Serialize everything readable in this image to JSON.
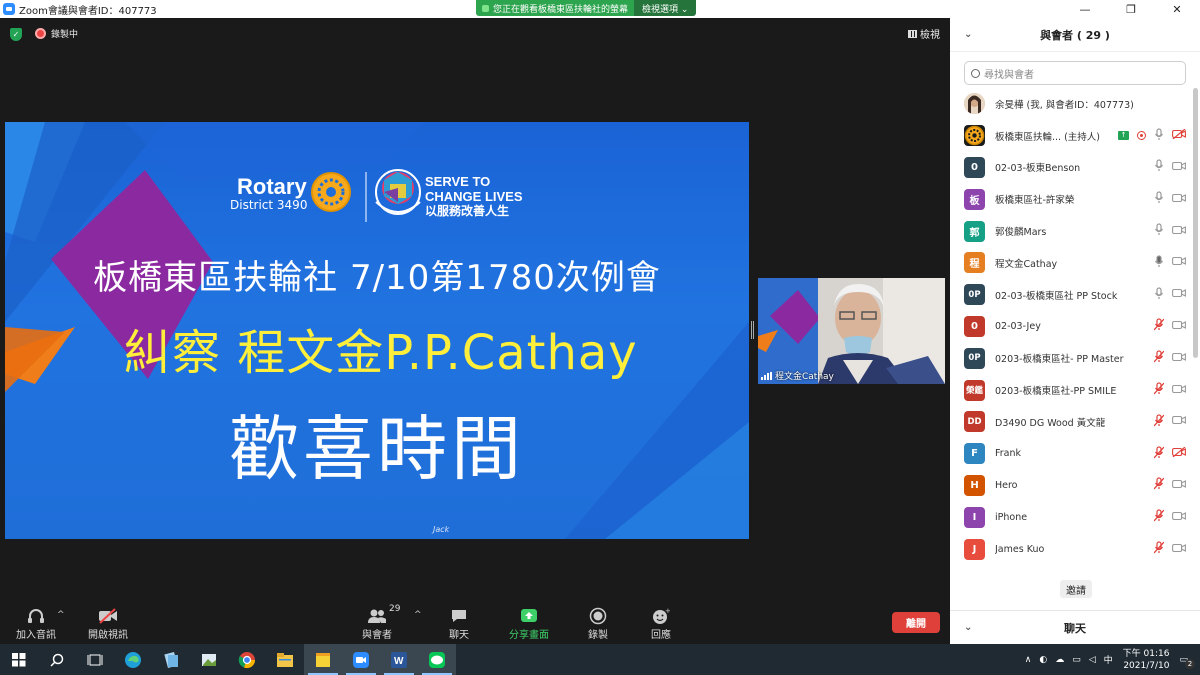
{
  "window": {
    "title": "Zoom會議與會者ID：407773",
    "minimize": "—",
    "maximize": "❐",
    "close": "✕"
  },
  "share_banner": {
    "text": "您正在觀看板橋東區扶輪社的螢幕",
    "options": "檢視選項 ⌄"
  },
  "stage": {
    "recording": "錄製中",
    "view": "檢視"
  },
  "slide": {
    "rotary": "Rotary",
    "district": "District 3490",
    "serve1": "SERVE TO",
    "serve2": "CHANGE LIVES",
    "serve_zh": "以服務改善人生",
    "line1": "板橋東區扶輪社  7/10第1780次例會",
    "line2": "糾察 程文金P.P.Cathay",
    "line3": "歡喜時間",
    "signature": "Jack"
  },
  "camera": {
    "name": "程文金Cathay"
  },
  "toolbar": {
    "audio": "加入音訊",
    "video": "開啟視訊",
    "participants": "與會者",
    "participant_count": "29",
    "chat": "聊天",
    "share": "分享畫面",
    "record": "錄製",
    "reactions": "回應",
    "leave": "離開"
  },
  "panel": {
    "title": "與會者 ( 29 )",
    "search_placeholder": "尋找與會者",
    "invite": "邀請",
    "chat": "聊天",
    "participants": [
      {
        "avatar": "",
        "name": "余旻樺 (我, 與會者ID：407773)",
        "color": "#c9a98d",
        "mic": "none",
        "video": "none",
        "photo": true
      },
      {
        "avatar": "",
        "name": "板橋東區扶輪... (主持人)",
        "color": "#1b1b1b",
        "mic": "on",
        "video": "off-red",
        "host": true
      },
      {
        "avatar": "0",
        "name": "02-03-板東Benson",
        "color": "#2f4858",
        "mic": "on",
        "video": "on"
      },
      {
        "avatar": "板",
        "name": "板橋東區社-許家榮",
        "color": "#8e44ad",
        "mic": "on",
        "video": "on"
      },
      {
        "avatar": "郭",
        "name": "郭俊麟Mars",
        "color": "#16a085",
        "mic": "on",
        "video": "on"
      },
      {
        "avatar": "程",
        "name": "程文金Cathay",
        "color": "#e67e22",
        "mic": "active",
        "video": "on"
      },
      {
        "avatar": "0P",
        "name": "02-03-板橋東區社 PP Stock",
        "color": "#2f4858",
        "mic": "on",
        "video": "on"
      },
      {
        "avatar": "0",
        "name": "02-03-Jey",
        "color": "#c0392b",
        "mic": "muted",
        "video": "on"
      },
      {
        "avatar": "0P",
        "name": "0203-板橋東區社- PP Master",
        "color": "#2f4858",
        "mic": "muted",
        "video": "on"
      },
      {
        "avatar": "榮鑑",
        "name": "0203-板橋東區社-PP SMILE",
        "color": "#c0392b",
        "mic": "muted",
        "video": "on"
      },
      {
        "avatar": "DD",
        "name": "D3490 DG  Wood 黃文龍",
        "color": "#c0392b",
        "mic": "muted",
        "video": "on"
      },
      {
        "avatar": "F",
        "name": "Frank",
        "color": "#2e86c1",
        "mic": "muted",
        "video": "off-red"
      },
      {
        "avatar": "H",
        "name": "Hero",
        "color": "#d35400",
        "mic": "muted",
        "video": "on"
      },
      {
        "avatar": "I",
        "name": "iPhone",
        "color": "#8e44ad",
        "mic": "muted",
        "video": "on"
      },
      {
        "avatar": "J",
        "name": "James Kuo",
        "color": "#e74c3c",
        "mic": "muted",
        "video": "on"
      }
    ]
  },
  "taskbar": {
    "time": "下午 01:16",
    "date": "2021/7/10",
    "ime": "中",
    "notif": "2"
  }
}
